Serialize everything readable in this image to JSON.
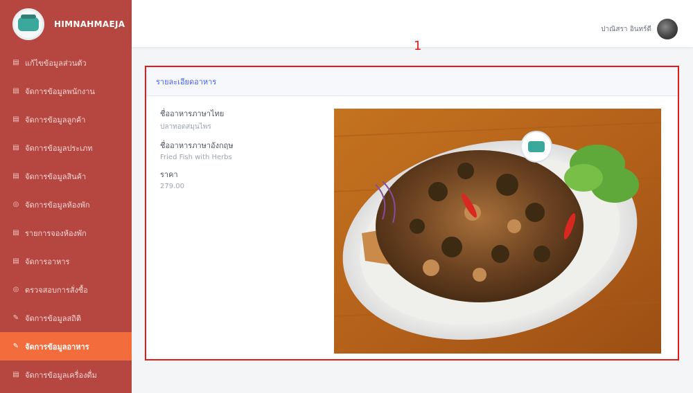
{
  "brand": {
    "name": "HIMNAHMAEJA"
  },
  "sidebar": {
    "items": [
      {
        "icon": "▤",
        "label": "แก้ไขข้อมูลส่วนตัว"
      },
      {
        "icon": "▤",
        "label": "จัดการข้อมูลพนักงาน"
      },
      {
        "icon": "▤",
        "label": "จัดการข้อมูลลูกค้า"
      },
      {
        "icon": "▤",
        "label": "จัดการข้อมูลประเภท"
      },
      {
        "icon": "▤",
        "label": "จัดการข้อมูลสินค้า"
      },
      {
        "icon": "◎",
        "label": "จัดการข้อมูลห้องพัก"
      },
      {
        "icon": "▤",
        "label": "รายการจองห้องพัก"
      },
      {
        "icon": "▤",
        "label": "จัดการอาหาร"
      },
      {
        "icon": "◎",
        "label": "ตรวจสอบการสั่งซื้อ"
      },
      {
        "icon": "✎",
        "label": "จัดการข้อมูลสถิติ"
      },
      {
        "icon": "✎",
        "label": "จัดการข้อมูลอาหาร",
        "active": true
      },
      {
        "icon": "▤",
        "label": "จัดการข้อมูลเครื่องดื่ม"
      }
    ]
  },
  "topbar": {
    "user_name": "ปาณิสรา อินทร์ดี"
  },
  "annotation": {
    "number": "1"
  },
  "card": {
    "title": "รายละเอียดอาหาร",
    "fields": [
      {
        "label": "ชื่ออาหารภาษาไทย",
        "value": "ปลาทอดสมุนไพร"
      },
      {
        "label": "ชื่ออาหารภาษาอังกฤษ",
        "value": "Fried Fish with Herbs"
      },
      {
        "label": "ราคา",
        "value": "279.00"
      }
    ]
  },
  "colors": {
    "sidebar": "#b64640",
    "active": "#f26c3c",
    "accent": "#4361ee",
    "annotation": "#e8191b"
  }
}
